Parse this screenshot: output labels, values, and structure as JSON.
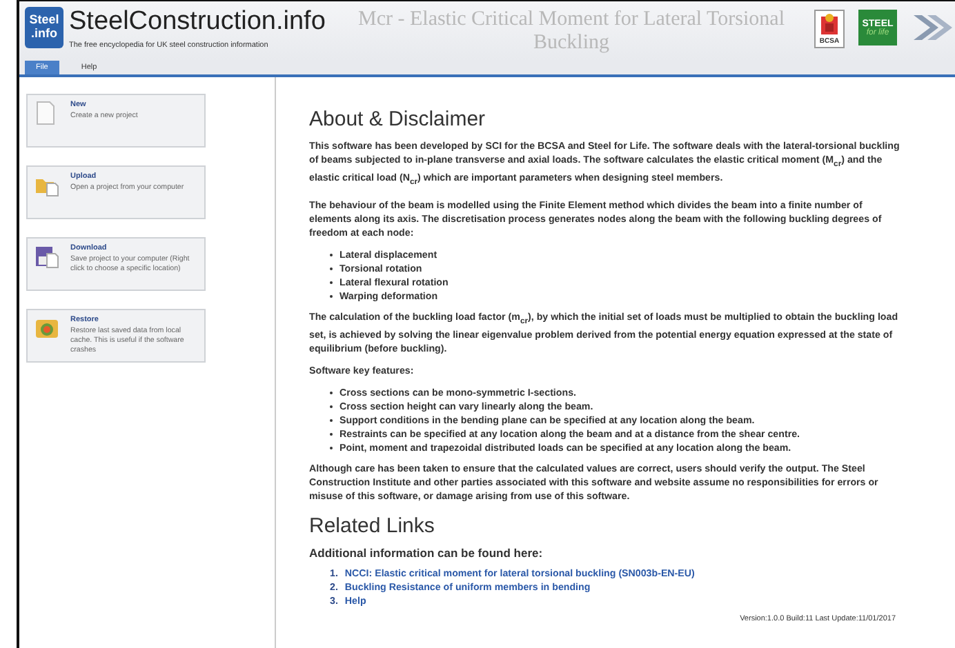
{
  "header": {
    "logo": {
      "top": "Steel",
      "bottom": ".info"
    },
    "site_name": "SteelConstruction.info",
    "tagline": "The free encyclopedia for UK steel construction information",
    "app_title": "Mcr - Elastic Critical Moment for Lateral Torsional Buckling",
    "partner_logos": [
      {
        "kind": "bcsa",
        "text": "BCSA"
      },
      {
        "kind": "steel",
        "text": "STEEL",
        "subtext": "for life"
      },
      {
        "kind": "sci"
      }
    ]
  },
  "tabs": [
    {
      "label": "File",
      "selected": true
    },
    {
      "label": "Help",
      "selected": false
    }
  ],
  "sidebar": {
    "items": [
      {
        "kind": "new",
        "title": "New",
        "description": "Create a new project"
      },
      {
        "kind": "upload",
        "title": "Upload",
        "description": "Open a project from your computer"
      },
      {
        "kind": "download",
        "title": "Download",
        "description": "Save project to your computer (Right click to choose a specific location)"
      },
      {
        "kind": "restore",
        "title": "Restore",
        "description": "Restore last saved data from local cache. This is useful if the software crashes"
      }
    ]
  },
  "about": {
    "heading": "About & Disclaimer",
    "blocks": [
      {
        "kind": "paragraph",
        "text": "This software has been developed by SCI for the BCSA and Steel for Life. The software deals with the lateral-torsional buckling of beams subjected to in-plane transverse and axial loads. The software calculates the elastic critical moment (M$_{cr}$) and the elastic critical load (N$_{cr}$) which are important parameters when designing steel members."
      },
      {
        "kind": "paragraph",
        "text": "The behaviour of the beam is modelled using the Finite Element method which divides the beam into a finite number of elements along its axis. The discretisation process generates nodes along the beam with the following buckling degrees of freedom at each node:"
      },
      {
        "kind": "list",
        "items": [
          "Lateral displacement",
          "Torsional rotation",
          "Lateral flexural rotation",
          "Warping deformation"
        ]
      },
      {
        "kind": "paragraph",
        "text": "The calculation of the buckling load factor (m$_{cr}$), by which the initial set of loads must be multiplied to obtain the buckling load set, is achieved by solving the linear eigenvalue problem derived from the potential energy equation expressed at the state of equilibrium (before buckling)."
      },
      {
        "kind": "paragraph",
        "text": "Software key features:"
      },
      {
        "kind": "list",
        "items": [
          "Cross sections can be mono-symmetric I-sections.",
          "Cross section height can vary linearly along the beam.",
          "Support conditions in the bending plane can be specified at any location along the beam.",
          "Restraints can be specified at any location along the beam and at a distance from the shear centre.",
          "Point, moment and trapezoidal distributed loads can be specified at any location along the beam."
        ]
      },
      {
        "kind": "paragraph",
        "text": "Although care has been taken to ensure that the calculated values are correct, users should verify the output. The Steel Construction Institute and other parties associated with this software and website assume no responsibilities for errors or misuse of this software, or damage arising from use of this software."
      }
    ]
  },
  "related": {
    "heading": "Related Links",
    "intro": "Additional information can be found here:",
    "links": [
      {
        "number": "1.",
        "text": "NCCI: Elastic critical moment for lateral torsional buckling (SN003b-EN-EU)"
      },
      {
        "number": "2.",
        "text": "Buckling Resistance of uniform members in bending"
      },
      {
        "number": "3.",
        "text": "Help"
      }
    ]
  },
  "version": "Version:1.0.0 Build:11 Last Update:11/01/2017"
}
